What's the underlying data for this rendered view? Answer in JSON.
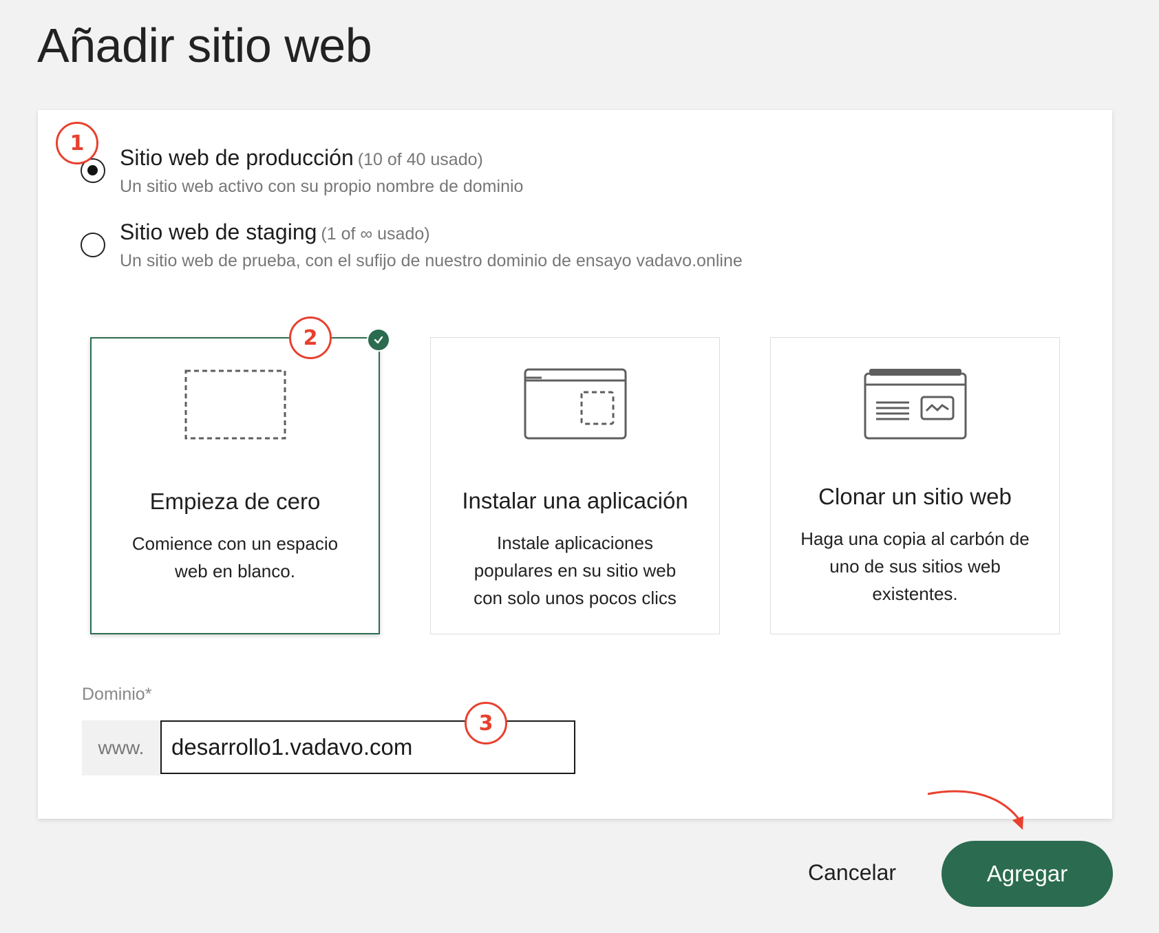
{
  "page": {
    "title": "Añadir sitio web"
  },
  "steps": [
    "1",
    "2",
    "3"
  ],
  "site_type": {
    "options": [
      {
        "title": "Sitio web de producción",
        "usage": "(10 of 40 usado)",
        "description": "Un sitio web activo con su propio nombre de dominio",
        "selected": true
      },
      {
        "title": "Sitio web de staging",
        "usage": "(1 of ∞ usado)",
        "description": "Un sitio web de prueba, con el sufijo de nuestro dominio de ensayo vadavo.online",
        "selected": false
      }
    ]
  },
  "creation": {
    "options": [
      {
        "title": "Empieza de cero",
        "description": "Comience con un espacio web en blanco.",
        "icon": "blank-canvas-icon",
        "selected": true
      },
      {
        "title": "Instalar una aplicación",
        "description": "Instale aplicaciones populares en su sitio web con solo unos pocos clics",
        "icon": "browser-window-icon",
        "selected": false
      },
      {
        "title": "Clonar un sitio web",
        "description": "Haga una copia al carbón de uno de sus sitios web existentes.",
        "icon": "website-layout-icon",
        "selected": false
      }
    ]
  },
  "domain": {
    "label": "Dominio*",
    "prefix": "www.",
    "value": "desarrollo1.vadavo.com"
  },
  "actions": {
    "cancel_label": "Cancelar",
    "add_label": "Agregar"
  },
  "colors": {
    "accent": "#2b6b4f",
    "annotation": "#e8402f",
    "background": "#f2f2f2"
  }
}
